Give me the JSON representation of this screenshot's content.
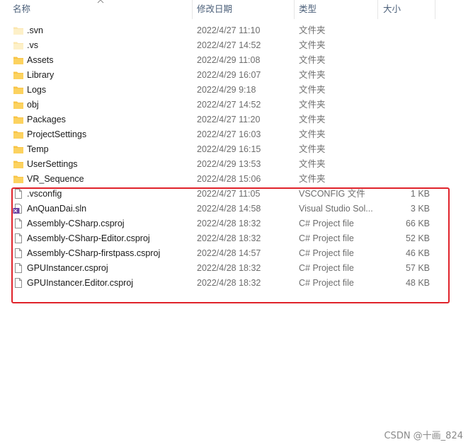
{
  "columns": {
    "name": "名称",
    "date": "修改日期",
    "type": "类型",
    "size": "大小"
  },
  "colors": {
    "accent_red": "#e0232b",
    "folder": "#f8c446",
    "header_text": "#4c607a"
  },
  "files": [
    {
      "name": ".svn",
      "date": "2022/4/27 11:10",
      "type": "文件夹",
      "size": "",
      "icon": "folder-hidden-icon"
    },
    {
      "name": ".vs",
      "date": "2022/4/27 14:52",
      "type": "文件夹",
      "size": "",
      "icon": "folder-hidden-icon"
    },
    {
      "name": "Assets",
      "date": "2022/4/29 11:08",
      "type": "文件夹",
      "size": "",
      "icon": "folder-icon"
    },
    {
      "name": "Library",
      "date": "2022/4/29 16:07",
      "type": "文件夹",
      "size": "",
      "icon": "folder-icon"
    },
    {
      "name": "Logs",
      "date": "2022/4/29 9:18",
      "type": "文件夹",
      "size": "",
      "icon": "folder-icon"
    },
    {
      "name": "obj",
      "date": "2022/4/27 14:52",
      "type": "文件夹",
      "size": "",
      "icon": "folder-icon"
    },
    {
      "name": "Packages",
      "date": "2022/4/27 11:20",
      "type": "文件夹",
      "size": "",
      "icon": "folder-icon"
    },
    {
      "name": "ProjectSettings",
      "date": "2022/4/27 16:03",
      "type": "文件夹",
      "size": "",
      "icon": "folder-icon"
    },
    {
      "name": "Temp",
      "date": "2022/4/29 16:15",
      "type": "文件夹",
      "size": "",
      "icon": "folder-icon"
    },
    {
      "name": "UserSettings",
      "date": "2022/4/29 13:53",
      "type": "文件夹",
      "size": "",
      "icon": "folder-icon"
    },
    {
      "name": "VR_Sequence",
      "date": "2022/4/28 15:06",
      "type": "文件夹",
      "size": "",
      "icon": "folder-icon"
    },
    {
      "name": ".vsconfig",
      "date": "2022/4/27 11:05",
      "type": "VSCONFIG 文件",
      "size": "1 KB",
      "icon": "file-icon"
    },
    {
      "name": "AnQuanDai.sln",
      "date": "2022/4/28 14:58",
      "type": "Visual Studio Sol...",
      "size": "3 KB",
      "icon": "visual-studio-solution-icon"
    },
    {
      "name": "Assembly-CSharp.csproj",
      "date": "2022/4/28 18:32",
      "type": "C# Project file",
      "size": "66 KB",
      "icon": "file-icon"
    },
    {
      "name": "Assembly-CSharp-Editor.csproj",
      "date": "2022/4/28 18:32",
      "type": "C# Project file",
      "size": "52 KB",
      "icon": "file-icon"
    },
    {
      "name": "Assembly-CSharp-firstpass.csproj",
      "date": "2022/4/28 14:57",
      "type": "C# Project file",
      "size": "46 KB",
      "icon": "file-icon"
    },
    {
      "name": "GPUInstancer.csproj",
      "date": "2022/4/28 18:32",
      "type": "C# Project file",
      "size": "57 KB",
      "icon": "file-icon"
    },
    {
      "name": "GPUInstancer.Editor.csproj",
      "date": "2022/4/28 18:32",
      "type": "C# Project file",
      "size": "48 KB",
      "icon": "file-icon"
    }
  ],
  "watermark": "CSDN @十画_824"
}
